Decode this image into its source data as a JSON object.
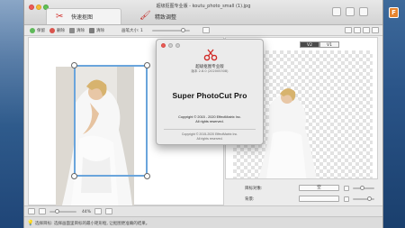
{
  "window": {
    "title": "超级抠图专业版 - koutu_photo_small (1).jpg"
  },
  "modes": {
    "quick_cutout": "快速抠图",
    "fine_adjust": "精致调整"
  },
  "toolbar": {
    "keep": "保留",
    "erase": "删除",
    "clear": "清除",
    "brush_size": "画笔大小: 1"
  },
  "preview": {
    "tabs": [
      "V2",
      "V1"
    ]
  },
  "settings": {
    "target_label": "目标对象:",
    "target_value": "空",
    "background_label": "背景:"
  },
  "bottom": {
    "zoom": "44%"
  },
  "status": {
    "text": "选择目标: 选择画面里目标的最小矩形框, 让抠图更准确的结果。"
  },
  "about": {
    "name_cn": "超级抠图专业版",
    "version": "版本 2.8.0 (202005308)",
    "name_en": "Super PhotoCut Pro",
    "copyright": "Copyright © 2015 - 2020 EffectMatrix Inc.",
    "rights": "All rights reserved.",
    "copyright2": "Copyright © 2015-2020 EffectMatrix Inc.",
    "rights2": "All rights reserved."
  },
  "colors": {
    "selection": "#6aa5dc",
    "logo_red": "#d12c28",
    "desktop_icon": "#e78530"
  }
}
